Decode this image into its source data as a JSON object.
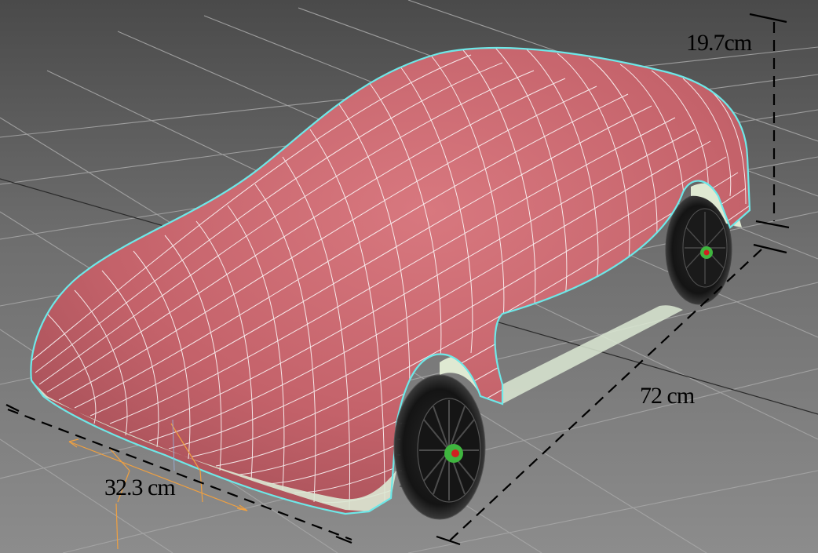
{
  "viewport": {
    "dimensions": {
      "height": "19.7cm",
      "length": "72 cm",
      "width": "32.3 cm"
    }
  },
  "colors": {
    "background_top": "#4c4c4c",
    "background_bottom": "#8e8e8e",
    "grid_line": "#a9a9a9",
    "body_fill": "#c9686f",
    "body_wire": "#ffffff",
    "selection_outline": "#6ee8e8",
    "tire": "#1c1c1c",
    "hub_green": "#3fb53f",
    "hub_red": "#d02020",
    "gizmo_orange": "#f0a040",
    "dimension_line": "#000000"
  },
  "icons": [
    "transform-gizmo-icon",
    "pivot-point-icon"
  ]
}
